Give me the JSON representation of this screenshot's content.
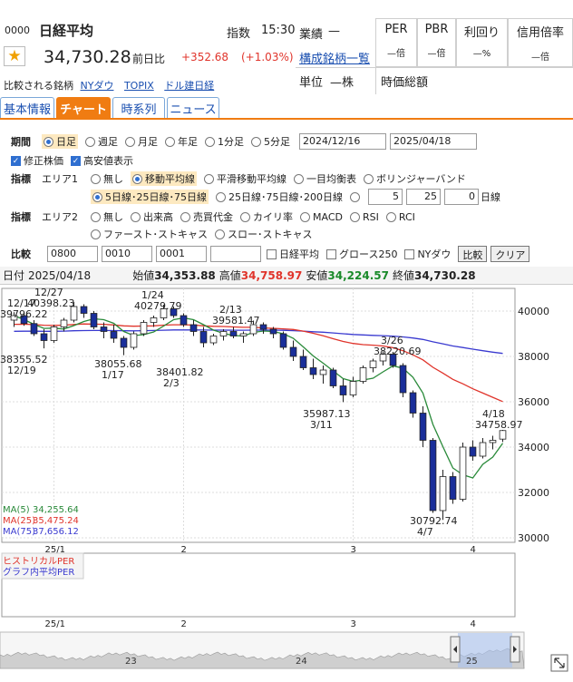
{
  "header": {
    "code": "0000",
    "name": "日経平均",
    "market_label": "指数",
    "time": "15:30",
    "price": "34,730.28",
    "change_label": "前日比",
    "change": "+352.68",
    "change_pct": "(+1.03%)",
    "compare_label": "比較される銘柄",
    "compare_links": [
      "NYダウ",
      "TOPIX",
      "ドル建日経"
    ],
    "performance_label": "業績",
    "performance_value": "—",
    "constituents_link": "構成銘柄一覧",
    "unit_label": "単位",
    "unit_value": "—株",
    "market_cap_label": "時価総額",
    "per_label": "PER",
    "per_value": "—倍",
    "pbr_label": "PBR",
    "pbr_value": "—倍",
    "yield_label": "利回り",
    "yield_value": "—%",
    "margin_label": "信用倍率",
    "margin_value": "—倍"
  },
  "tabs": [
    "基本情報",
    "チャート",
    "時系列",
    "ニュース"
  ],
  "controls": {
    "period_label": "期間",
    "periods": [
      "日足",
      "週足",
      "月足",
      "年足",
      "1分足",
      "5分足"
    ],
    "selected_period": "日足",
    "date_from": "2024/12/16",
    "date_to": "2025/04/18",
    "adjusted_label": "修正株価",
    "high_low_label": "高安値表示",
    "indicator_label": "指標",
    "area1_label": "エリア1",
    "area1_options": [
      "無し",
      "移動平均線",
      "平滑移動平均線",
      "一目均衡表",
      "ボリンジャーバンド"
    ],
    "area1_selected": "移動平均線",
    "ma_options": [
      "5日線･25日線･75日線",
      "25日線･75日線･200日線"
    ],
    "ma_custom": [
      "5",
      "25",
      "0"
    ],
    "ma_custom_unit": "日線",
    "area2_label": "エリア2",
    "area2_options": [
      "無し",
      "出来高",
      "売買代金",
      "カイリ率",
      "MACD",
      "RSI",
      "RCI"
    ],
    "area2_options_row2": [
      "ファースト･ストキャス",
      "スロー･ストキャス"
    ],
    "compare_label": "比較",
    "compare_codes": [
      "0800",
      "0010",
      "0001",
      ""
    ],
    "compare_checks": [
      "日経平均",
      "グロース250",
      "NYダウ"
    ],
    "compare_button": "比較",
    "clear_button": "クリア"
  },
  "infobar": {
    "date_label": "日付",
    "date": "2025/04/18",
    "open_label": "始値",
    "open": "34,353.88",
    "high_label": "高値",
    "high": "34,758.97",
    "low_label": "安値",
    "low": "34,224.57",
    "close_label": "終値",
    "close": "34,730.28"
  },
  "chart_data": {
    "type": "candlestick",
    "x_ticks": [
      "25/1",
      "2",
      "3",
      "4"
    ],
    "y_ticks": [
      "40000",
      "38000",
      "36000",
      "34000",
      "32000",
      "30000"
    ],
    "ylim": [
      29800,
      41000
    ],
    "colors": {
      "up": "#ffffff",
      "down": "#1a2f9a",
      "ma5": "#2a8a3a",
      "ma25": "#e0342b",
      "ma75": "#3a3ad0"
    },
    "candles": [
      [
        39600,
        39950,
        39300,
        39800
      ],
      [
        39800,
        39900,
        39350,
        39450
      ],
      [
        39450,
        39600,
        38900,
        39000
      ],
      [
        39000,
        39200,
        38355,
        38700
      ],
      [
        38700,
        39400,
        38600,
        39300
      ],
      [
        39300,
        39700,
        39100,
        39600
      ],
      [
        39600,
        40398,
        39500,
        40200
      ],
      [
        40200,
        40300,
        39700,
        39900
      ],
      [
        39900,
        40000,
        39200,
        39300
      ],
      [
        39300,
        39500,
        38800,
        39100
      ],
      [
        39100,
        39400,
        38600,
        38800
      ],
      [
        38800,
        38900,
        38055,
        38400
      ],
      [
        38400,
        39100,
        38300,
        39000
      ],
      [
        39000,
        39600,
        38900,
        39500
      ],
      [
        39500,
        39800,
        39300,
        39700
      ],
      [
        39700,
        40279,
        39600,
        40100
      ],
      [
        40100,
        40200,
        39700,
        39800
      ],
      [
        39800,
        39900,
        39300,
        39400
      ],
      [
        39400,
        39600,
        38900,
        39100
      ],
      [
        39100,
        39300,
        38401,
        38600
      ],
      [
        38600,
        39000,
        38500,
        38900
      ],
      [
        38900,
        39200,
        38700,
        39100
      ],
      [
        39100,
        39300,
        38800,
        38900
      ],
      [
        38900,
        39100,
        38600,
        39000
      ],
      [
        39000,
        39581,
        38900,
        39400
      ],
      [
        39400,
        39500,
        39000,
        39200
      ],
      [
        39200,
        39300,
        38800,
        39000
      ],
      [
        39000,
        39100,
        38300,
        38400
      ],
      [
        38400,
        38700,
        37800,
        38000
      ],
      [
        38000,
        38300,
        37400,
        37500
      ],
      [
        37500,
        37900,
        37000,
        37200
      ],
      [
        37200,
        37600,
        36800,
        37400
      ],
      [
        37400,
        37500,
        36600,
        36700
      ],
      [
        36700,
        37000,
        35987,
        36300
      ],
      [
        36300,
        37100,
        36200,
        36900
      ],
      [
        36900,
        37600,
        36800,
        37500
      ],
      [
        37500,
        37900,
        37300,
        37800
      ],
      [
        37800,
        38220,
        37600,
        38100
      ],
      [
        38100,
        38200,
        37500,
        37600
      ],
      [
        37600,
        37700,
        36200,
        36400
      ],
      [
        36400,
        36500,
        35300,
        35500
      ],
      [
        35500,
        35800,
        34000,
        34300
      ],
      [
        34300,
        34400,
        31100,
        31200
      ],
      [
        31200,
        33000,
        30792,
        32700
      ],
      [
        32700,
        32900,
        31500,
        31700
      ],
      [
        31700,
        34200,
        31600,
        34000
      ],
      [
        34000,
        34300,
        33400,
        33600
      ],
      [
        33600,
        34400,
        33500,
        34200
      ],
      [
        34200,
        34500,
        33900,
        34300
      ],
      [
        34353,
        34758,
        34224,
        34730
      ]
    ],
    "annotations": [
      {
        "label": "12/17",
        "value": "39796.22"
      },
      {
        "label": "12/27",
        "value": "40398.23"
      },
      {
        "label": "12/19",
        "value": "38355.52"
      },
      {
        "label": "1/24",
        "value": "40279.79"
      },
      {
        "label": "1/17",
        "value": "38055.68"
      },
      {
        "label": "2/13",
        "value": "39581.47"
      },
      {
        "label": "2/3",
        "value": "38401.82"
      },
      {
        "label": "3/26",
        "value": "38220.69"
      },
      {
        "label": "3/11",
        "value": "35987.13"
      },
      {
        "label": "4/18",
        "value": "34758.97"
      },
      {
        "label": "4/7",
        "value": "30792.74"
      }
    ],
    "legend": [
      {
        "name": "MA(5)",
        "value": "34,255.64"
      },
      {
        "name": "MA(25)",
        "value": "35,475.24"
      },
      {
        "name": "MA(75)",
        "value": "37,656.12"
      }
    ],
    "subchart_legend": [
      "ヒストリカルPER",
      "グラフ内平均PER"
    ],
    "navigator_ticks": [
      "23",
      "24",
      "25"
    ]
  }
}
